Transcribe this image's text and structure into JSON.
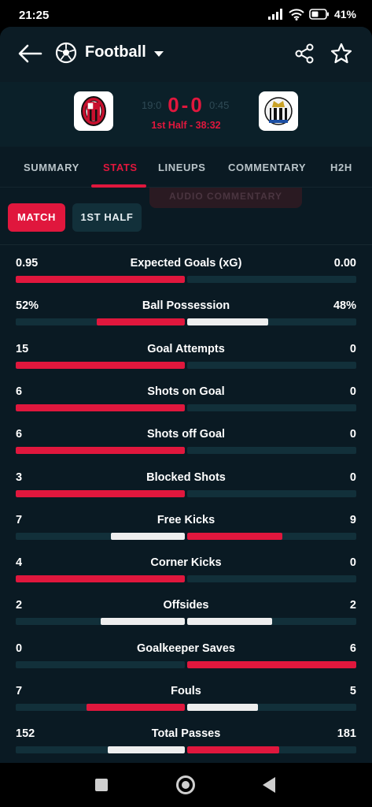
{
  "status_bar": {
    "time": "21:25",
    "battery": "41%"
  },
  "header": {
    "title": "Football"
  },
  "match": {
    "score_home": "0",
    "score_separator": "-",
    "score_away": "0",
    "status": "1st Half - 38:32",
    "ghost_time_left": "19:0",
    "ghost_time_right": "0:45"
  },
  "tabs": [
    {
      "label": "SUMMARY",
      "active": false
    },
    {
      "label": "STATS",
      "active": true
    },
    {
      "label": "LINEUPS",
      "active": false
    },
    {
      "label": "COMMENTARY",
      "active": false
    },
    {
      "label": "H2H",
      "active": false
    }
  ],
  "ghost_banner": "AUDIO COMMENTARY",
  "filters": {
    "match": "MATCH",
    "half": "1ST HALF"
  },
  "colors": {
    "accent": "#e0173d",
    "away_bar": "#eeeeee",
    "track": "#12303a",
    "panel": "#0a1a23"
  },
  "stats": [
    {
      "name": "Expected Goals (xG)",
      "home": "0.95",
      "away": "0.00",
      "home_share": 1.0,
      "away_share": 0.0,
      "leader": "home"
    },
    {
      "name": "Ball Possession",
      "home": "52%",
      "away": "48%",
      "home_share": 0.52,
      "away_share": 0.48,
      "leader": "home"
    },
    {
      "name": "Goal Attempts",
      "home": "15",
      "away": "0",
      "home_share": 1.0,
      "away_share": 0.0,
      "leader": "home"
    },
    {
      "name": "Shots on Goal",
      "home": "6",
      "away": "0",
      "home_share": 1.0,
      "away_share": 0.0,
      "leader": "home"
    },
    {
      "name": "Shots off Goal",
      "home": "6",
      "away": "0",
      "home_share": 1.0,
      "away_share": 0.0,
      "leader": "home"
    },
    {
      "name": "Blocked Shots",
      "home": "3",
      "away": "0",
      "home_share": 1.0,
      "away_share": 0.0,
      "leader": "home"
    },
    {
      "name": "Free Kicks",
      "home": "7",
      "away": "9",
      "home_share": 0.4375,
      "away_share": 0.5625,
      "leader": "away"
    },
    {
      "name": "Corner Kicks",
      "home": "4",
      "away": "0",
      "home_share": 1.0,
      "away_share": 0.0,
      "leader": "home"
    },
    {
      "name": "Offsides",
      "home": "2",
      "away": "2",
      "home_share": 0.5,
      "away_share": 0.5,
      "leader": "none"
    },
    {
      "name": "Goalkeeper Saves",
      "home": "0",
      "away": "6",
      "home_share": 0.0,
      "away_share": 1.0,
      "leader": "away"
    },
    {
      "name": "Fouls",
      "home": "7",
      "away": "5",
      "home_share": 0.5833,
      "away_share": 0.4167,
      "leader": "home"
    },
    {
      "name": "Total Passes",
      "home": "152",
      "away": "181",
      "home_share": 0.4565,
      "away_share": 0.5435,
      "leader": "away"
    }
  ]
}
